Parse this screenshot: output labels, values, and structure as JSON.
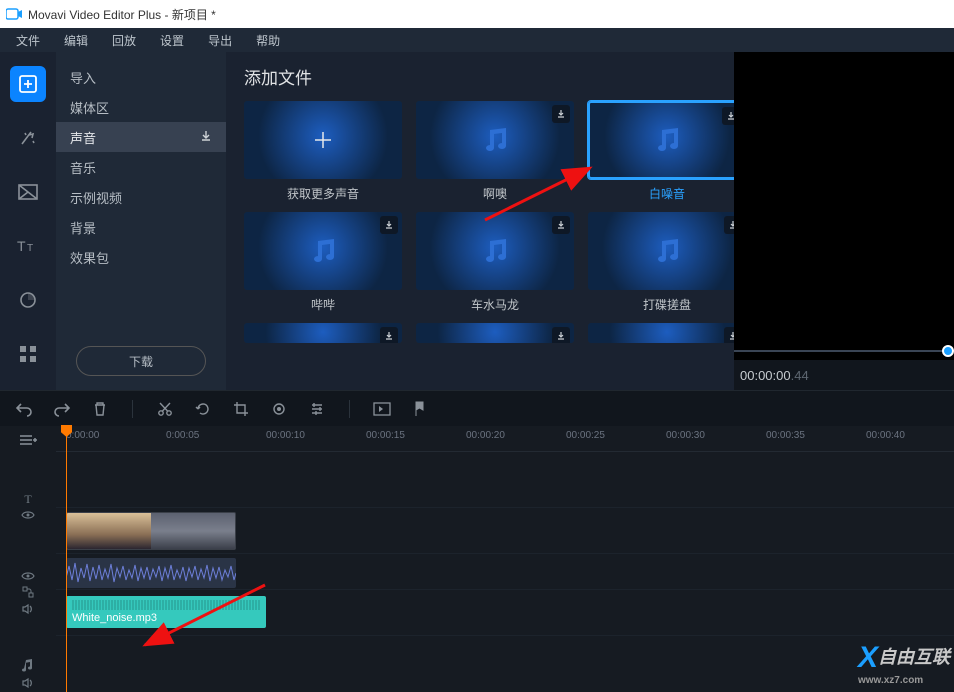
{
  "titlebar": {
    "text": "Movavi Video Editor Plus - 新项目 *"
  },
  "menubar": [
    "文件",
    "编辑",
    "回放",
    "设置",
    "导出",
    "帮助"
  ],
  "sidebar": {
    "items": [
      {
        "label": "导入"
      },
      {
        "label": "媒体区"
      },
      {
        "label": "声音",
        "active": true,
        "dl": true
      },
      {
        "label": "音乐"
      },
      {
        "label": "示例视频"
      },
      {
        "label": "背景"
      },
      {
        "label": "效果包"
      }
    ],
    "download_label": "下载"
  },
  "content": {
    "title": "添加文件",
    "tiles": [
      {
        "label": "获取更多声音",
        "plus": true
      },
      {
        "label": "啊噢",
        "dl": true
      },
      {
        "label": "白噪音",
        "dl": true,
        "selected": true
      },
      {
        "label": "哔哔",
        "dl": true
      },
      {
        "label": "车水马龙",
        "dl": true
      },
      {
        "label": "打碟搓盘",
        "dl": true
      },
      {
        "label": "",
        "dl": true,
        "partial": true
      },
      {
        "label": "",
        "dl": true,
        "partial": true
      },
      {
        "label": "",
        "dl": true,
        "partial": true
      }
    ]
  },
  "preview": {
    "time": "00:00:00",
    "frames": ".44"
  },
  "ruler": [
    "0:00:00",
    "0:00:05",
    "00:00:10",
    "00:00:15",
    "00:00:20",
    "00:00:25",
    "00:00:30",
    "00:00:35",
    "00:00:40"
  ],
  "clip": {
    "audio_name": "White_noise.mp3"
  },
  "watermark": {
    "brand": "自由互联",
    "url": "www.xz7.com"
  }
}
